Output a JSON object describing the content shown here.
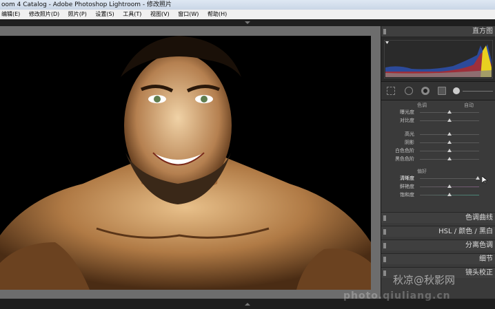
{
  "window": {
    "title": "oom 4 Catalog - Adobe Photoshop Lightroom - 修改照片"
  },
  "menu": [
    "编辑(E)",
    "修改照片(D)",
    "照片(P)",
    "设置(S)",
    "工具(T)",
    "视图(V)",
    "窗口(W)",
    "帮助(H)"
  ],
  "panel": {
    "histogram_title": "直方图",
    "basic": {
      "tone_header_left": "色调",
      "tone_header_right": "自动",
      "exposure": {
        "label": "曝光度",
        "value": 0.5
      },
      "contrast": {
        "label": "对比度",
        "value": 0.5
      },
      "highlights": {
        "label": "高光",
        "value": 0.5
      },
      "shadows": {
        "label": "阴影",
        "value": 0.5
      },
      "whites": {
        "label": "白色色阶",
        "value": 0.5
      },
      "blacks": {
        "label": "黑色色阶",
        "value": 0.5
      },
      "presence_header": "偏好",
      "clarity": {
        "label": "清晰度",
        "value": 0.98
      },
      "vibrance": {
        "label": "鲜艳度",
        "value": 0.5
      },
      "saturation": {
        "label": "饱和度",
        "value": 0.5
      }
    },
    "collapsed": [
      {
        "label": "色调曲线"
      },
      {
        "label": "HSL / 颜色 / 黑白"
      },
      {
        "label": "分离色调"
      },
      {
        "label": "细节"
      },
      {
        "label": "镜头校正"
      }
    ]
  },
  "watermark": {
    "text": "秋凉@秋影网",
    "url": "photo.qiuliang.cn"
  },
  "colors": {
    "panel_bg": "#3a3a3a",
    "viewer_bg": "#6d6d6d",
    "menu_bg": "#f0f0f0"
  }
}
